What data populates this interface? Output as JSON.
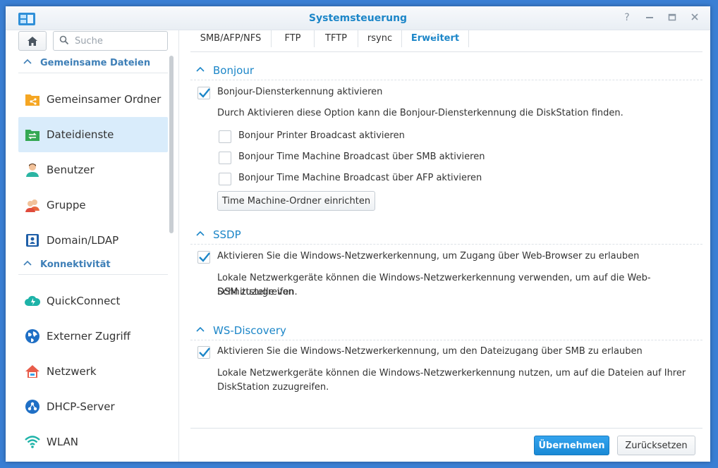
{
  "window": {
    "title": "Systemsteuerung",
    "controls": [
      "help-icon",
      "minimize-icon",
      "maximize-icon",
      "close-icon"
    ]
  },
  "sidebar": {
    "search_placeholder": "Suche",
    "sections": [
      {
        "label": "Gemeinsame Dateien",
        "items": [
          {
            "label": "Gemeinsamer Ordner",
            "icon": "shared-folder-icon"
          },
          {
            "label": "Dateidienste",
            "icon": "file-services-icon",
            "active": true
          },
          {
            "label": "Benutzer",
            "icon": "user-icon"
          },
          {
            "label": "Gruppe",
            "icon": "group-icon"
          },
          {
            "label": "Domain/LDAP",
            "icon": "domain-ldap-icon"
          }
        ]
      },
      {
        "label": "Konnektivität",
        "items": [
          {
            "label": "QuickConnect",
            "icon": "quickconnect-icon"
          },
          {
            "label": "Externer Zugriff",
            "icon": "globe-icon"
          },
          {
            "label": "Netzwerk",
            "icon": "network-icon"
          },
          {
            "label": "DHCP-Server",
            "icon": "dhcp-icon"
          },
          {
            "label": "WLAN",
            "icon": "wifi-icon"
          }
        ]
      }
    ]
  },
  "tabs": [
    {
      "label": "SMB/AFP/NFS"
    },
    {
      "label": "FTP"
    },
    {
      "label": "TFTP"
    },
    {
      "label": "rsync"
    },
    {
      "label": "Erweitert",
      "active": true
    }
  ],
  "bonjour": {
    "title": "Bonjour",
    "enable_label": "Bonjour-Diensterkennung aktivieren",
    "enable_checked": true,
    "description": "Durch Aktivieren diese Option kann die Bonjour-Diensterkennung die DiskStation finden.",
    "options": [
      {
        "label": "Bonjour Printer Broadcast aktivieren",
        "checked": false
      },
      {
        "label": "Bonjour Time Machine Broadcast über SMB aktivieren",
        "checked": false
      },
      {
        "label": "Bonjour Time Machine Broadcast über AFP aktivieren",
        "checked": false
      }
    ],
    "button_label": "Time Machine-Ordner einrichten"
  },
  "ssdp": {
    "title": "SSDP",
    "enable_label": "Aktivieren Sie die Windows-Netzwerkerkennung, um Zugang über Web-Browser zu erlauben",
    "enable_checked": true,
    "description_line1": "Lokale Netzwerkgeräte können die Windows-Netzwerkerkennung verwenden, um auf die Web-Schnittstelle von",
    "description_line2": "DSM zuzugreifen."
  },
  "ws_discovery": {
    "title": "WS-Discovery",
    "enable_label": "Aktivieren Sie die Windows-Netzwerkerkennung, um den Dateizugang über SMB zu erlauben",
    "enable_checked": true,
    "description_line1": "Lokale Netzwerkgeräte können die Windows-Netzwerkerkennung nutzen, um auf die Dateien auf Ihrer",
    "description_line2": "DiskStation zuzugreifen."
  },
  "footer": {
    "apply_label": "Übernehmen",
    "reset_label": "Zurücksetzen"
  },
  "colors": {
    "accent": "#1c86c8",
    "desktop": "#3a7fd4",
    "active_item": "#d9ecfb",
    "primary_button": "#1a8ad6"
  }
}
